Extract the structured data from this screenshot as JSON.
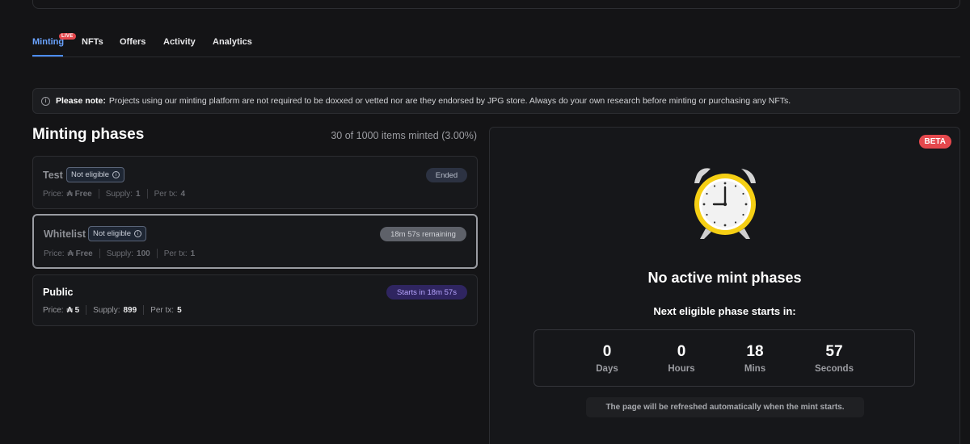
{
  "tabs": [
    {
      "label": "Minting",
      "badge": "LIVE",
      "active": true
    },
    {
      "label": "NFTs"
    },
    {
      "label": "Offers"
    },
    {
      "label": "Activity"
    },
    {
      "label": "Analytics"
    }
  ],
  "note": {
    "icon": "info-icon",
    "bold": "Please note:",
    "text": "Projects using our minting platform are not required to be doxxed or vetted nor are they endorsed by JPG store. Always do your own research before minting or purchasing any NFTs."
  },
  "phases_title": "Minting phases",
  "minted_text": "30 of 1000 items minted (3.00%)",
  "labels": {
    "price": "Price:",
    "supply": "Supply:",
    "per_tx": "Per tx:"
  },
  "phases": [
    {
      "name": "Test",
      "eligibility": "Not eligible",
      "status": "Ended",
      "price": "₳ Free",
      "supply": "1",
      "per_tx": "4"
    },
    {
      "name": "Whitelist",
      "eligibility": "Not eligible",
      "status": "18m 57s remaining",
      "price": "₳ Free",
      "supply": "100",
      "per_tx": "1"
    },
    {
      "name": "Public",
      "status": "Starts in 18m 57s",
      "price": "₳ 5",
      "supply": "899",
      "per_tx": "5"
    }
  ],
  "mint_panel": {
    "beta": "BETA",
    "icon": "alarm-clock-icon",
    "headline": "No active mint phases",
    "subheadline": "Next eligible phase starts in:",
    "countdown": [
      {
        "value": "0",
        "label": "Days"
      },
      {
        "value": "0",
        "label": "Hours"
      },
      {
        "value": "18",
        "label": "Mins"
      },
      {
        "value": "57",
        "label": "Seconds"
      }
    ],
    "refresh_note": "The page will be refreshed automatically when the mint starts."
  },
  "colors": {
    "accent": "#4b8cff",
    "live_badge": "#e5484d",
    "clock_ring": "#f5cf14",
    "starts_pill": "#2f2560"
  }
}
